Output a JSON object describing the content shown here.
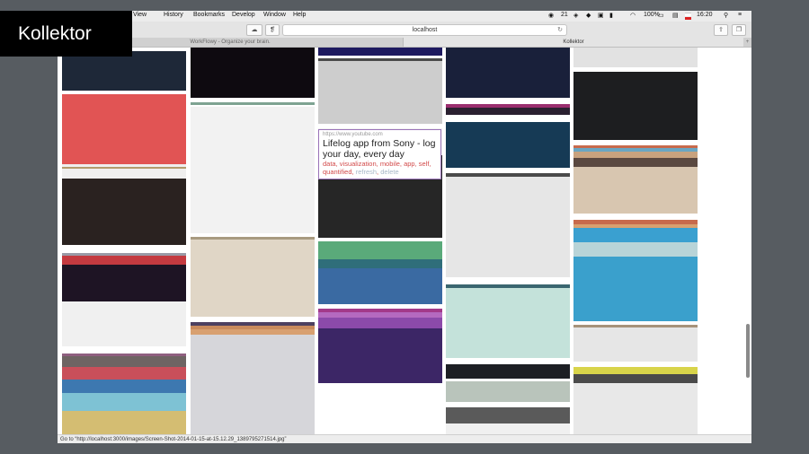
{
  "logo": {
    "text": "Kollektor"
  },
  "menubar": {
    "items": [
      "View",
      "History",
      "Bookmarks",
      "Develop",
      "Window",
      "Help"
    ],
    "badge": "21",
    "battery": "100%",
    "time": "16:20"
  },
  "toolbar": {
    "url": "localhost"
  },
  "tabs": [
    {
      "label": "WorkFlowy - Organize your brain."
    },
    {
      "label": "Kollektor"
    }
  ],
  "card": {
    "source": "https://www.youtube.com",
    "title": "Lifelog app from Sony - log your day, every day",
    "tags": [
      "data",
      "visualization",
      "mobile",
      "app",
      "self",
      "quantified"
    ],
    "actions": [
      "refresh",
      "delete"
    ]
  },
  "status": {
    "text": "Go to “http://localhost:3000/images/Screen-Shot-2014-01-15-at-15.12.29_1389795271514.jpg”"
  },
  "columns": [
    [
      {
        "h": 52,
        "bands": [
          {
            "c": "#ffffff",
            "h": 4
          },
          {
            "c": "#1e2838",
            "h": 44
          },
          {
            "c": "#ffffff",
            "h": 4
          }
        ]
      },
      {
        "h": 78,
        "bands": [
          {
            "c": "#e15454",
            "h": 78
          }
        ]
      },
      {
        "h": 16,
        "bands": [
          {
            "c": "#efefef",
            "h": 3
          },
          {
            "c": "#b49a6c",
            "h": 2
          },
          {
            "c": "#efefef",
            "h": 11
          }
        ]
      },
      {
        "h": 74,
        "bands": [
          {
            "c": "#2a2220",
            "h": 74
          }
        ]
      },
      {
        "h": 9,
        "bands": [
          {
            "c": "#ffffff",
            "h": 9
          }
        ]
      },
      {
        "h": 54,
        "bands": [
          {
            "c": "#9a9aa6",
            "h": 3
          },
          {
            "c": "#c43a40",
            "h": 10
          },
          {
            "c": "#1e1424",
            "h": 41
          }
        ]
      },
      {
        "h": 50,
        "bands": [
          {
            "c": "#f0f0f0",
            "h": 50
          }
        ]
      },
      {
        "h": 8,
        "bands": [
          {
            "c": "#ffffff",
            "h": 8
          }
        ]
      },
      {
        "h": 102,
        "bands": [
          {
            "c": "#8f5f80",
            "h": 3
          },
          {
            "c": "#6e6463",
            "h": 12
          },
          {
            "c": "#c94f5a",
            "h": 14
          },
          {
            "c": "#3d78b0",
            "h": 15
          },
          {
            "c": "#7ec2d4",
            "h": 20
          },
          {
            "c": "#d4bd72",
            "h": 38
          }
        ]
      }
    ],
    [
      {
        "h": 58,
        "bands": [
          {
            "c": "#0e0a10",
            "h": 56
          },
          {
            "c": "#ffffff",
            "h": 2
          }
        ]
      },
      {
        "h": 8,
        "bands": [
          {
            "c": "#ffffff",
            "h": 3
          },
          {
            "c": "#7ea392",
            "h": 3
          },
          {
            "c": "#ffffff",
            "h": 2
          }
        ]
      },
      {
        "h": 141,
        "bands": [
          {
            "c": "#f2f2f2",
            "h": 141
          }
        ]
      },
      {
        "h": 4,
        "bands": [
          {
            "c": "#ffffff",
            "h": 4
          }
        ]
      },
      {
        "h": 89,
        "bands": [
          {
            "c": "#a89a80",
            "h": 3
          },
          {
            "c": "#e0d6c6",
            "h": 86
          }
        ]
      },
      {
        "h": 6,
        "bands": [
          {
            "c": "#ffffff",
            "h": 6
          }
        ]
      },
      {
        "h": 14,
        "bands": [
          {
            "c": "#4d4060",
            "h": 4
          },
          {
            "c": "#c98a5c",
            "h": 4
          },
          {
            "c": "#d8a070",
            "h": 6
          }
        ]
      },
      {
        "h": 111,
        "bands": [
          {
            "c": "#d6d6da",
            "h": 111
          }
        ]
      }
    ],
    [
      {
        "h": 9,
        "bands": [
          {
            "c": "#1e1a60",
            "h": 9
          }
        ]
      },
      {
        "h": 6,
        "bands": [
          {
            "c": "#ffffff",
            "h": 3
          },
          {
            "c": "#4a4a4a",
            "h": 3
          }
        ]
      },
      {
        "h": 70,
        "bands": [
          {
            "c": "#cdcdcd",
            "h": 70
          }
        ]
      },
      {
        "h": 5,
        "bands": [
          {
            "c": "#ffffff",
            "h": 5
          }
        ]
      },
      {
        "h": 30,
        "bands": [
          {
            "c": "#f0f0f0",
            "h": 30
          }
        ]
      },
      {
        "h": 92,
        "bands": [
          {
            "c": "#262626",
            "h": 92
          }
        ]
      },
      {
        "h": 4,
        "bands": [
          {
            "c": "#ffffff",
            "h": 4
          }
        ]
      },
      {
        "h": 70,
        "bands": [
          {
            "c": "#5aaa7a",
            "h": 20
          },
          {
            "c": "#2f6e7a",
            "h": 10
          },
          {
            "c": "#3a6aa2",
            "h": 40
          }
        ]
      },
      {
        "h": 5,
        "bands": [
          {
            "c": "#ffffff",
            "h": 5
          }
        ]
      },
      {
        "h": 83,
        "bands": [
          {
            "c": "#a33a8a",
            "h": 4
          },
          {
            "c": "#b56ac0",
            "h": 6
          },
          {
            "c": "#8c4aaa",
            "h": 12
          },
          {
            "c": "#3c2666",
            "h": 61
          }
        ]
      }
    ],
    [
      {
        "h": 58,
        "bands": [
          {
            "c": "#19203a",
            "h": 56
          },
          {
            "c": "#ffffff",
            "h": 2
          }
        ]
      },
      {
        "h": 5,
        "bands": [
          {
            "c": "#ffffff",
            "h": 5
          }
        ]
      },
      {
        "h": 12,
        "bands": [
          {
            "c": "#9a2d6e",
            "h": 4
          },
          {
            "c": "#2a2030",
            "h": 8
          }
        ]
      },
      {
        "h": 8,
        "bands": [
          {
            "c": "#ffffff",
            "h": 8
          }
        ]
      },
      {
        "h": 51,
        "bands": [
          {
            "c": "#163a55",
            "h": 51
          }
        ]
      },
      {
        "h": 6,
        "bands": [
          {
            "c": "#ffffff",
            "h": 6
          }
        ]
      },
      {
        "h": 116,
        "bands": [
          {
            "c": "#4a4a4a",
            "h": 4
          },
          {
            "c": "#e6e6e6",
            "h": 112
          }
        ]
      },
      {
        "h": 8,
        "bands": [
          {
            "c": "#ffffff",
            "h": 8
          }
        ]
      },
      {
        "h": 82,
        "bands": [
          {
            "c": "#3a6670",
            "h": 4
          },
          {
            "c": "#c4e2da",
            "h": 78
          }
        ]
      },
      {
        "h": 7,
        "bands": [
          {
            "c": "#ffffff",
            "h": 7
          }
        ]
      },
      {
        "h": 42,
        "bands": [
          {
            "c": "#1d1f24",
            "h": 16
          },
          {
            "c": "#ffffff",
            "h": 3
          },
          {
            "c": "#b9c4bb",
            "h": 23
          }
        ]
      },
      {
        "h": 6,
        "bands": [
          {
            "c": "#ffffff",
            "h": 6
          }
        ]
      },
      {
        "h": 34,
        "bands": [
          {
            "c": "#5a5a5a",
            "h": 18
          },
          {
            "c": "#f0f0f0",
            "h": 16
          }
        ]
      }
    ],
    [
      {
        "h": 22,
        "bands": [
          {
            "c": "#e2e2e2",
            "h": 22
          }
        ]
      },
      {
        "h": 5,
        "bands": [
          {
            "c": "#ffffff",
            "h": 5
          }
        ]
      },
      {
        "h": 76,
        "bands": [
          {
            "c": "#1d1e20",
            "h": 76
          }
        ]
      },
      {
        "h": 6,
        "bands": [
          {
            "c": "#ffffff",
            "h": 6
          }
        ]
      },
      {
        "h": 76,
        "bands": [
          {
            "c": "#c86a4c",
            "h": 3
          },
          {
            "c": "#6aa6c2",
            "h": 4
          },
          {
            "c": "#c8a27e",
            "h": 7
          },
          {
            "c": "#5a4840",
            "h": 10
          },
          {
            "c": "#d8c6b0",
            "h": 52
          }
        ]
      },
      {
        "h": 7,
        "bands": [
          {
            "c": "#ffffff",
            "h": 7
          }
        ]
      },
      {
        "h": 113,
        "bands": [
          {
            "c": "#c86a4c",
            "h": 5
          },
          {
            "c": "#d8a070",
            "h": 4
          },
          {
            "c": "#3aa0d0",
            "h": 16
          },
          {
            "c": "#b8d4d8",
            "h": 16
          },
          {
            "c": "#3aa0cc",
            "h": 72
          }
        ]
      },
      {
        "h": 4,
        "bands": [
          {
            "c": "#ffffff",
            "h": 4
          }
        ]
      },
      {
        "h": 41,
        "bands": [
          {
            "c": "#a6927a",
            "h": 3
          },
          {
            "c": "#e6e6e6",
            "h": 38
          }
        ]
      },
      {
        "h": 6,
        "bands": [
          {
            "c": "#ffffff",
            "h": 6
          }
        ]
      },
      {
        "h": 80,
        "bands": [
          {
            "c": "#d8d44a",
            "h": 8
          },
          {
            "c": "#4a4a4a",
            "h": 10
          },
          {
            "c": "#e8e8e8",
            "h": 62
          }
        ]
      }
    ]
  ]
}
